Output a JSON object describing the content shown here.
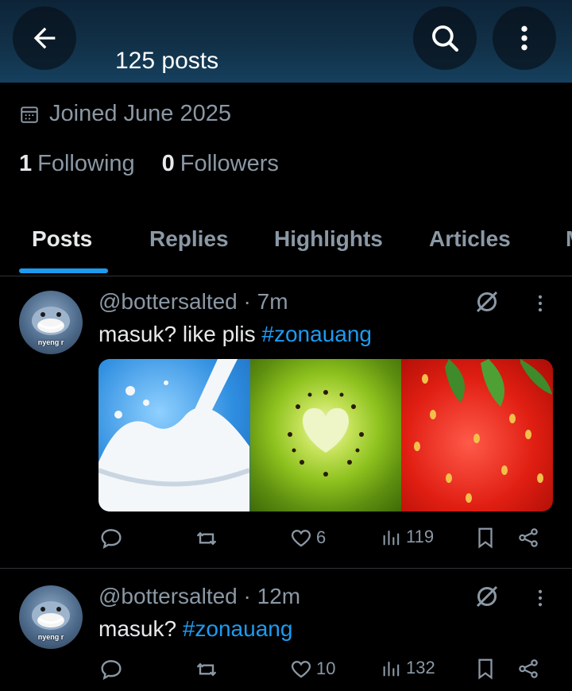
{
  "header": {
    "posts_count": "125 posts",
    "back_icon": "arrow-left-icon",
    "search_icon": "search-icon",
    "more_icon": "more-vertical-icon"
  },
  "profile": {
    "joined": "Joined June 2025",
    "following_count": "1",
    "following_label": "Following",
    "followers_count": "0",
    "followers_label": "Followers"
  },
  "tabs": [
    {
      "label": "Posts",
      "active": true
    },
    {
      "label": "Replies",
      "active": false
    },
    {
      "label": "Highlights",
      "active": false
    },
    {
      "label": "Articles",
      "active": false
    }
  ],
  "posts": [
    {
      "avatar_label": "nyeng r",
      "handle": "@bottersalted",
      "time": "7m",
      "text": "masuk? like plis ",
      "hashtag": "#zonauang",
      "likes": "6",
      "views": "119",
      "has_media": true
    },
    {
      "avatar_label": "nyeng r",
      "handle": "@bottersalted",
      "time": "12m",
      "text": "masuk? ",
      "hashtag": "#zonauang",
      "likes": "10",
      "views": "132",
      "has_media": false
    }
  ],
  "colors": {
    "accent": "#1d9bf0",
    "muted": "#8b98a5",
    "text": "#e7e9ea",
    "background": "#000000"
  }
}
